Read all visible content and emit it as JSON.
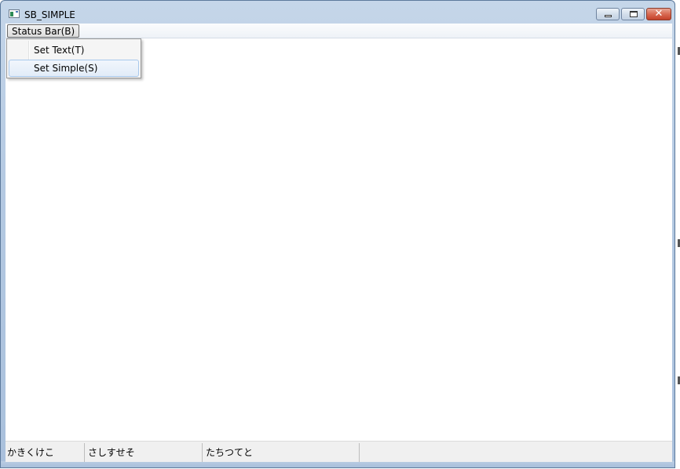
{
  "window": {
    "title": "SB_SIMPLE",
    "controls": {
      "minimize": "minimize",
      "maximize": "restore",
      "close": "close"
    }
  },
  "menubar": {
    "items": [
      {
        "label": "Status Bar(B)"
      }
    ]
  },
  "dropdown": {
    "items": [
      {
        "label": "Set Text(T)"
      },
      {
        "label": "Set Simple(S)"
      }
    ]
  },
  "statusbar": {
    "parts": [
      {
        "text": "かきくけこ"
      },
      {
        "text": "さしすせそ"
      },
      {
        "text": "たちつてと"
      },
      {
        "text": ""
      }
    ]
  },
  "colors": {
    "frame": "#b4c9e2",
    "close_button": "#d86a52",
    "menu_hover": "#e2ecf8"
  }
}
